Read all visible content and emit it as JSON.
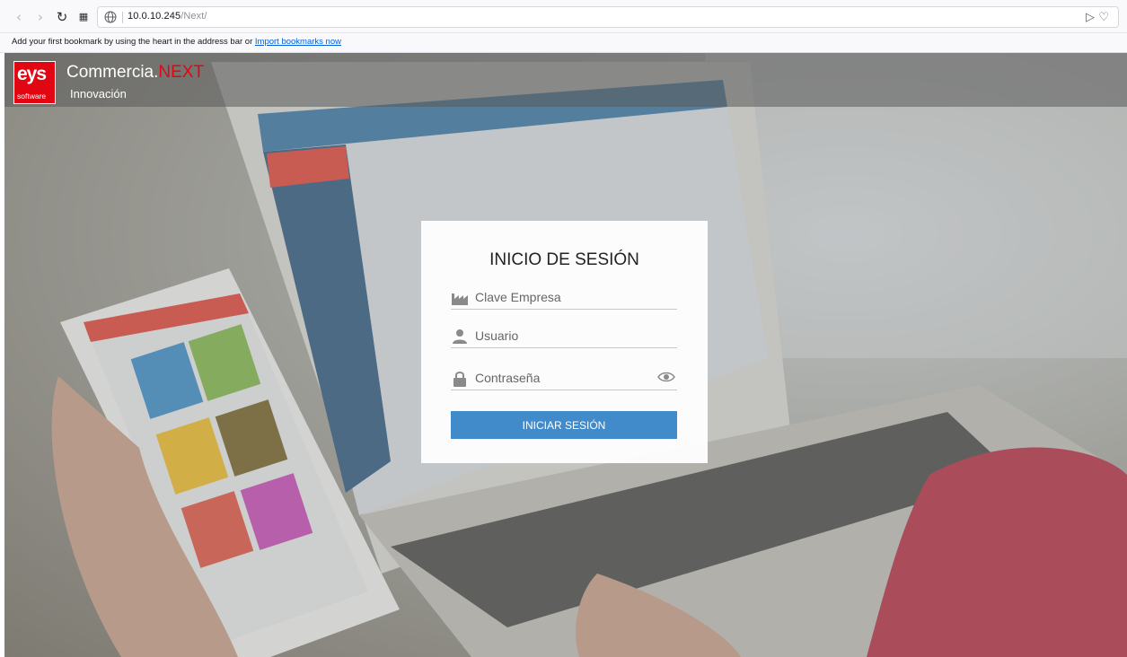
{
  "browser": {
    "url_host": "10.0.10.245",
    "url_path": "/Next/",
    "bookmarks_message": "Add your first bookmark by using the heart in the address bar or",
    "import_link": "Import bookmarks now"
  },
  "header": {
    "logo_text": "eys",
    "logo_subtext": "software",
    "brand_name": "Commercia.",
    "brand_suffix": "NEXT",
    "tagline": "Innovación"
  },
  "login": {
    "title": "INICIO DE SESIÓN",
    "company_placeholder": "Clave Empresa",
    "user_placeholder": "Usuario",
    "password_placeholder": "Contraseña",
    "submit_label": "INICIAR SESIÓN"
  },
  "colors": {
    "brand_red": "#e20613",
    "button_blue": "#428bca"
  }
}
